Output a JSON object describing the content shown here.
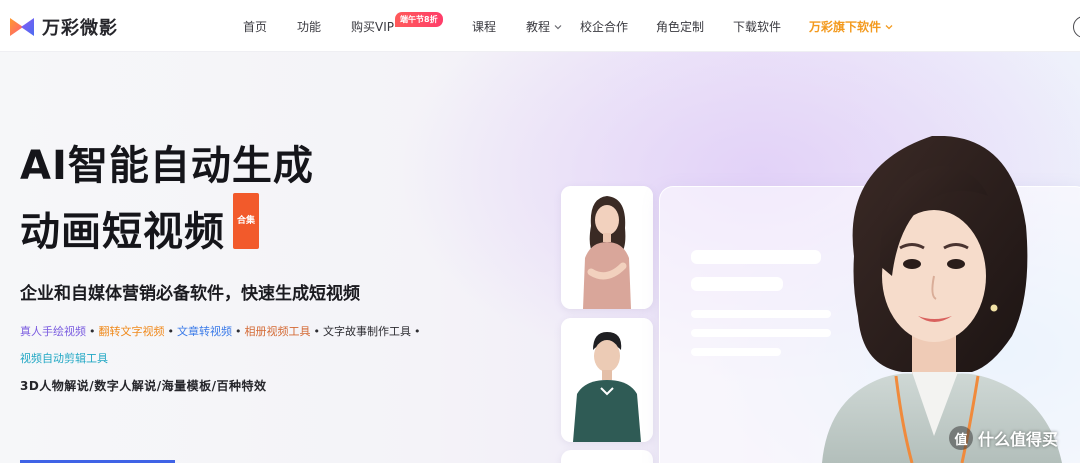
{
  "brand": {
    "name": "万彩微影"
  },
  "nav": {
    "items": [
      {
        "label": "首页"
      },
      {
        "label": "功能"
      },
      {
        "label": "购买VIP"
      },
      {
        "label": "课程"
      },
      {
        "label": "教程"
      },
      {
        "label": "校企合作"
      },
      {
        "label": "角色定制"
      },
      {
        "label": "下载软件"
      },
      {
        "label": "万彩旗下软件"
      }
    ],
    "promo_badge": "端午节8折"
  },
  "hero": {
    "title_line1": "AI智能自动生成",
    "title_line2": "动画短视频",
    "title_badge": "合集",
    "subtitle": "企业和自媒体营销必备软件，快速生成短视频",
    "features": [
      {
        "label": "真人手绘视频",
        "color": "#7b5ce0"
      },
      {
        "label": "翻转文字视频",
        "color": "#f08a1c"
      },
      {
        "label": "文章转视频",
        "color": "#3a7ae8"
      },
      {
        "label": "相册视频工具",
        "color": "#d46a35"
      },
      {
        "label": "文字故事制作工具",
        "color": "#2d2d32"
      },
      {
        "label": "视频自动剪辑工具",
        "color": "#21a7c4"
      }
    ],
    "feature_separator": "•",
    "line3": "3D人物解说/数字人解说/海量模板/百种特效"
  },
  "watermark": {
    "icon_char": "值",
    "text": "什么值得买"
  },
  "colors": {
    "accent_orange": "#f39a1e",
    "promo_red": "#ff4a5e",
    "title_badge": "#f25a2b",
    "cta_blue": "#3f63e6"
  }
}
